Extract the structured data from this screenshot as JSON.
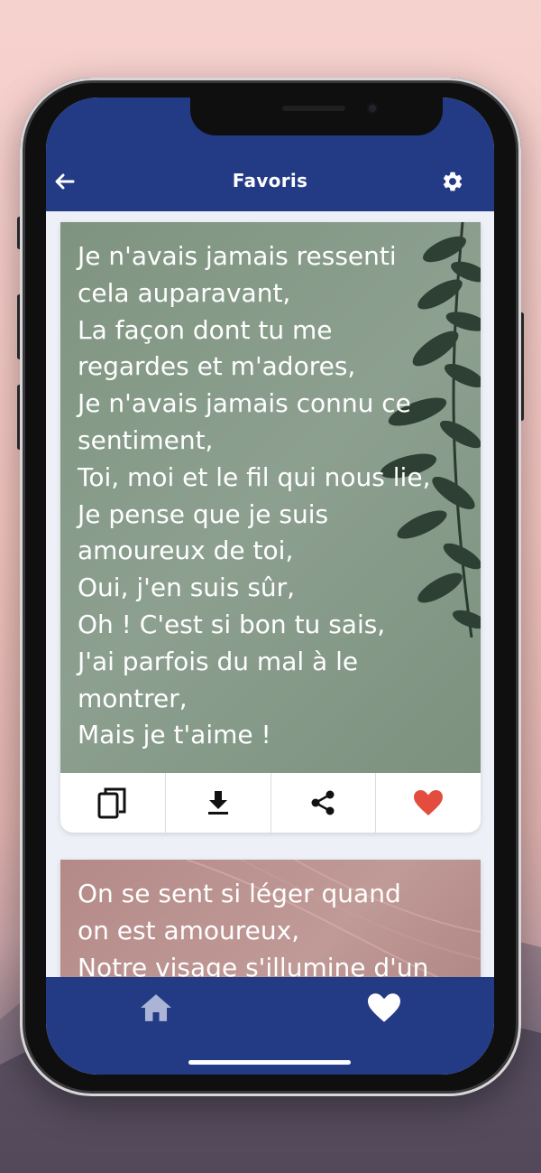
{
  "header": {
    "title": "Favoris"
  },
  "icons": {
    "back": "arrow-left-icon",
    "settings": "gear-icon",
    "copy": "copy-icon",
    "download": "download-icon",
    "share": "share-icon",
    "favorite": "heart-icon",
    "home": "home-icon",
    "favorites_tab": "heart-icon"
  },
  "colors": {
    "appbar": "#233a84",
    "heart_active": "#e24d3d",
    "home_inactive": "#a9b4d6"
  },
  "quotes": [
    {
      "text": "Je n'avais jamais ressenti\ncela auparavant,\nLa façon dont tu me\nregardes et m'adores,\nJe n'avais jamais connu ce\nsentiment,\nToi, moi et le fil qui nous lie,\nJe pense que je suis\namoureux de toi,\nOui, j'en suis sûr,\nOh ! C'est si bon tu sais,\nJ'ai parfois du mal à le\nmontrer,\nMais je t'aime !"
    },
    {
      "text": "On se sent si léger quand\non est amoureux,\nNotre visage s'illumine d'un"
    }
  ]
}
